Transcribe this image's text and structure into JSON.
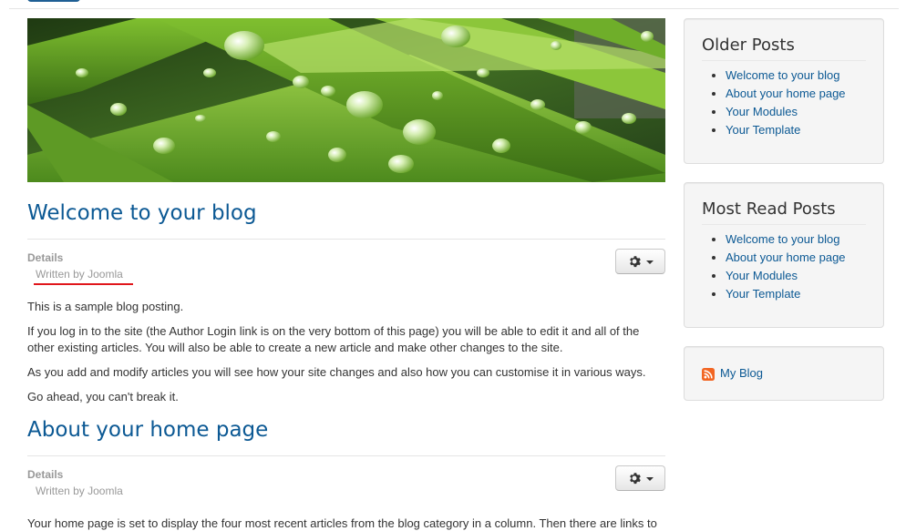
{
  "articles": [
    {
      "title": "Welcome to your blog",
      "details_label": "Details",
      "author": "Written by Joomla",
      "paragraphs": [
        "This is a sample blog posting.",
        "If you log in to the site (the Author Login link is on the very bottom of this page) you will be able to edit it and all of the other existing articles. You will also be able to create a new article and make other changes to the site.",
        "As you add and modify articles you will see how your site changes and also how you can customise it in various ways.",
        "Go ahead, you can't break it."
      ]
    },
    {
      "title": "About your home page",
      "details_label": "Details",
      "author": "Written by Joomla",
      "paragraphs": [
        "Your home page is set to display the four most recent articles from the blog category in a column. Then there are links to"
      ]
    }
  ],
  "sidebar": {
    "older_posts": {
      "title": "Older Posts",
      "items": [
        "Welcome to your blog",
        "About your home page",
        "Your Modules",
        "Your Template"
      ]
    },
    "most_read": {
      "title": "Most Read Posts",
      "items": [
        "Welcome to your blog",
        "About your home page",
        "Your Modules",
        "Your Template"
      ]
    },
    "feed": {
      "label": "My Blog"
    }
  },
  "colors": {
    "link": "#0c5994",
    "annotation": "#e0161b"
  },
  "icons": {
    "article_tools": "gear-icon",
    "dropdown": "caret-down-icon",
    "feed": "rss-icon"
  }
}
